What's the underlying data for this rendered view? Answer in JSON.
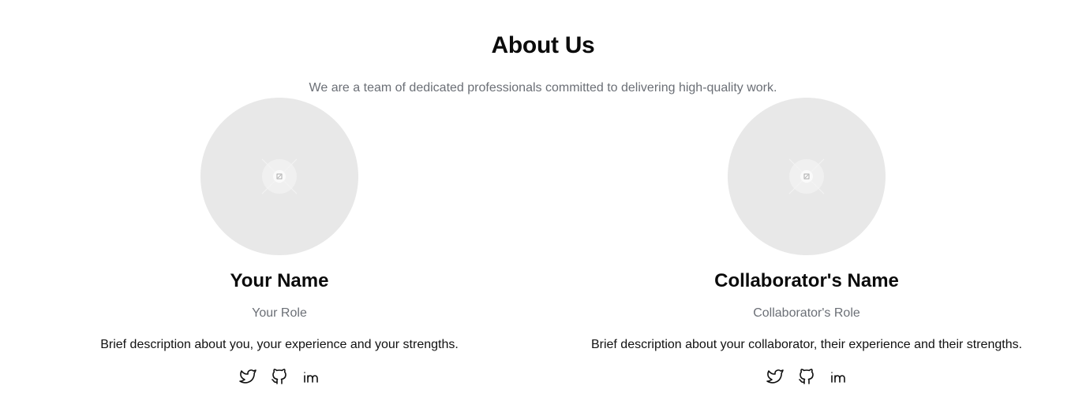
{
  "header": {
    "title": "About Us",
    "subtitle": "We are a team of dedicated professionals committed to delivering high-quality work."
  },
  "members": [
    {
      "name": "Your Name",
      "role": "Your Role",
      "description": "Brief description about you, your experience and your strengths.",
      "socials": [
        "twitter-icon",
        "github-icon",
        "linkedin-icon"
      ]
    },
    {
      "name": "Collaborator's Name",
      "role": "Collaborator's Role",
      "description": "Brief description about your collaborator, their experience and their strengths.",
      "socials": [
        "twitter-icon",
        "github-icon",
        "linkedin-icon"
      ]
    }
  ],
  "colors": {
    "background": "#ffffff",
    "avatar_placeholder": "#e8e8e8",
    "muted_text": "#6b6f76",
    "heading_text": "#0b0b0b"
  }
}
